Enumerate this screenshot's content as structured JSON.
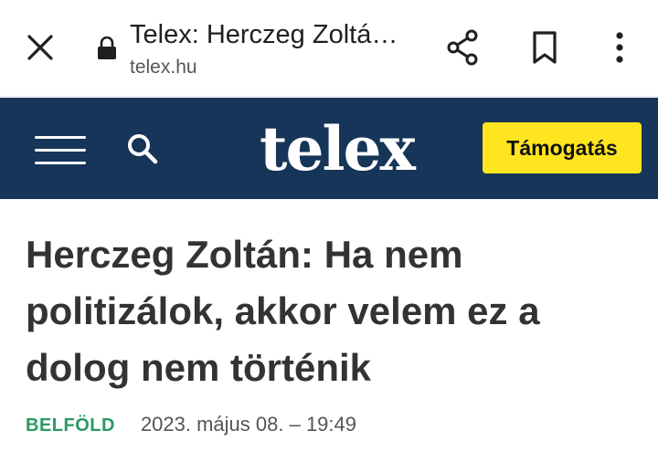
{
  "browser": {
    "page_title": "Telex: Herczeg Zoltá…",
    "domain": "telex.hu",
    "icons": {
      "close": "close-icon",
      "lock": "lock-icon",
      "share": "share-icon",
      "bookmark": "bookmark-icon",
      "menu": "more-vert-icon"
    }
  },
  "site": {
    "logo": "telex",
    "support_label": "Támogatás",
    "colors": {
      "header_bg": "#163558",
      "support_bg": "#ffe51f",
      "category": "#2a9a63"
    }
  },
  "article": {
    "headline": "Herczeg Zoltán: Ha nem politizálok, akkor velem ez a dolog nem történik",
    "category": "BELFÖLD",
    "date": "2023. május 08. – 19:49"
  }
}
